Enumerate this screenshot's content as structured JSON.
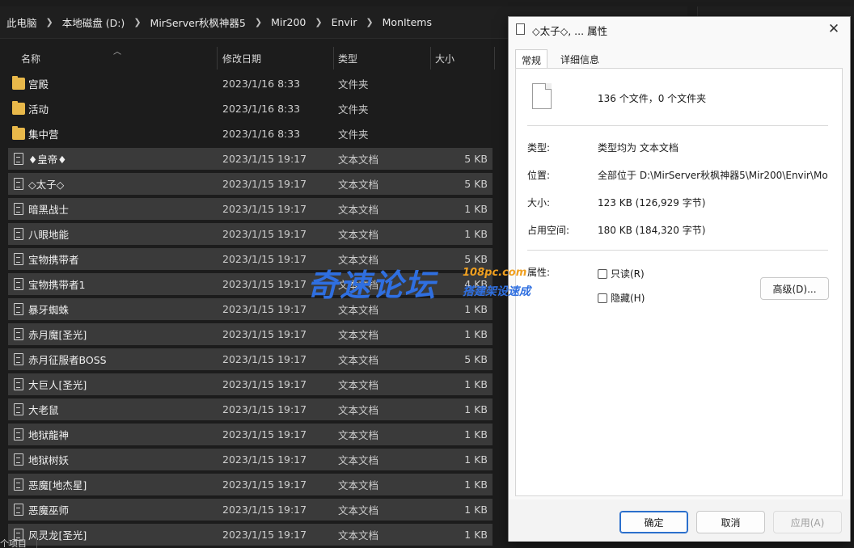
{
  "breadcrumb": [
    "此电脑",
    "本地磁盘 (D:)",
    "MirServer秋枫神器5",
    "Mir200",
    "Envir",
    "MonItems"
  ],
  "columns": {
    "name": "名称",
    "date": "修改日期",
    "type": "类型",
    "size": "大小"
  },
  "files": [
    {
      "name": "宫殿",
      "date": "2023/1/16 8:33",
      "type": "文件夹",
      "size": "",
      "kind": "folder",
      "selected": false
    },
    {
      "name": "活动",
      "date": "2023/1/16 8:33",
      "type": "文件夹",
      "size": "",
      "kind": "folder",
      "selected": false
    },
    {
      "name": "集中营",
      "date": "2023/1/16 8:33",
      "type": "文件夹",
      "size": "",
      "kind": "folder",
      "selected": false
    },
    {
      "name": "♦皇帝♦",
      "date": "2023/1/15 19:17",
      "type": "文本文档",
      "size": "5 KB",
      "kind": "file",
      "selected": true
    },
    {
      "name": "◇太子◇",
      "date": "2023/1/15 19:17",
      "type": "文本文档",
      "size": "5 KB",
      "kind": "file",
      "selected": true
    },
    {
      "name": "暗黑战士",
      "date": "2023/1/15 19:17",
      "type": "文本文档",
      "size": "1 KB",
      "kind": "file",
      "selected": true
    },
    {
      "name": "八眼地能",
      "date": "2023/1/15 19:17",
      "type": "文本文档",
      "size": "1 KB",
      "kind": "file",
      "selected": true
    },
    {
      "name": "宝物携带者",
      "date": "2023/1/15 19:17",
      "type": "文本文档",
      "size": "5 KB",
      "kind": "file",
      "selected": true
    },
    {
      "name": "宝物携带者1",
      "date": "2023/1/15 19:17",
      "type": "文本文档",
      "size": "4 KB",
      "kind": "file",
      "selected": true
    },
    {
      "name": "暴牙蜘蛛",
      "date": "2023/1/15 19:17",
      "type": "文本文档",
      "size": "1 KB",
      "kind": "file",
      "selected": true
    },
    {
      "name": "赤月魔[圣光]",
      "date": "2023/1/15 19:17",
      "type": "文本文档",
      "size": "1 KB",
      "kind": "file",
      "selected": true
    },
    {
      "name": "赤月征服者BOSS",
      "date": "2023/1/15 19:17",
      "type": "文本文档",
      "size": "5 KB",
      "kind": "file",
      "selected": true
    },
    {
      "name": "大巨人[圣光]",
      "date": "2023/1/15 19:17",
      "type": "文本文档",
      "size": "1 KB",
      "kind": "file",
      "selected": true
    },
    {
      "name": "大老鼠",
      "date": "2023/1/15 19:17",
      "type": "文本文档",
      "size": "1 KB",
      "kind": "file",
      "selected": true
    },
    {
      "name": "地狱龍神",
      "date": "2023/1/15 19:17",
      "type": "文本文档",
      "size": "1 KB",
      "kind": "file",
      "selected": true
    },
    {
      "name": "地狱树妖",
      "date": "2023/1/15 19:17",
      "type": "文本文档",
      "size": "1 KB",
      "kind": "file",
      "selected": true
    },
    {
      "name": "恶魔[地杰星]",
      "date": "2023/1/15 19:17",
      "type": "文本文档",
      "size": "1 KB",
      "kind": "file",
      "selected": true
    },
    {
      "name": "恶魔巫师",
      "date": "2023/1/15 19:17",
      "type": "文本文档",
      "size": "1 KB",
      "kind": "file",
      "selected": true
    },
    {
      "name": "风灵龙[圣光]",
      "date": "2023/1/15 19:17",
      "type": "文本文档",
      "size": "1 KB",
      "kind": "file",
      "selected": true
    }
  ],
  "statusbar": {
    "text": "个项目"
  },
  "dialog": {
    "title": "◇太子◇, ... 属性",
    "close": "✕",
    "tabs": [
      "常规",
      "详细信息"
    ],
    "count": "136 个文件，0 个文件夹",
    "props": [
      {
        "label": "类型:",
        "value": "类型均为 文本文档"
      },
      {
        "label": "位置:",
        "value": "全部位于 D:\\MirServer秋枫神器5\\Mir200\\Envir\\Mo"
      },
      {
        "label": "大小:",
        "value": "123 KB (126,929 字节)"
      },
      {
        "label": "占用空间:",
        "value": "180 KB (184,320 字节)"
      }
    ],
    "attributes_label": "属性:",
    "readonly": "只读(R)",
    "hidden": "隐藏(H)",
    "advanced": "高级(D)...",
    "ok": "确定",
    "cancel": "取消",
    "apply": "应用(A)"
  },
  "watermark": {
    "main": "奇速论坛",
    "domain": "108pc.com",
    "sub": "搭建架设速成"
  },
  "colors": {
    "explorer_bg": "#1c1c1c",
    "selection": "#3a3a3a",
    "folder": "#e8b84a",
    "accent": "#2b6fcc",
    "watermark_blue": "#2f6fe0",
    "watermark_orange": "#f0a020"
  }
}
